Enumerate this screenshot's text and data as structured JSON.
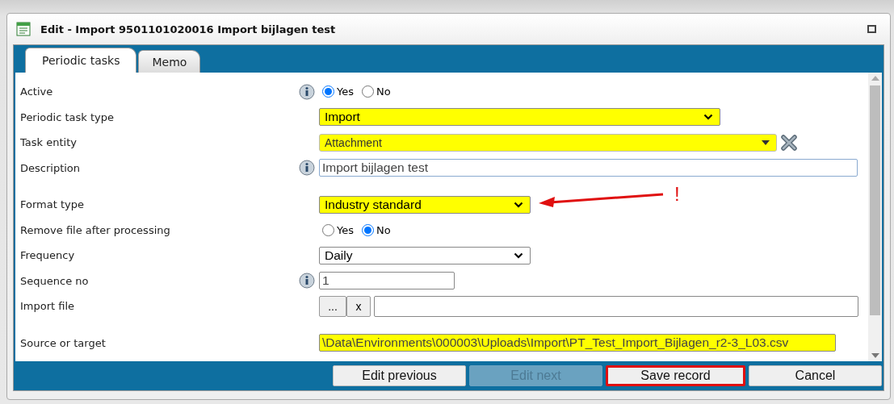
{
  "window": {
    "title": "Edit - Import 9501101020016 Import bijlagen test"
  },
  "tabs": [
    {
      "label": "Periodic tasks",
      "selected": true
    },
    {
      "label": "Memo",
      "selected": false
    }
  ],
  "fields": [
    {
      "label": "Active",
      "kind": "radio",
      "info": true,
      "options": [
        {
          "label": "Yes",
          "selected": true
        },
        {
          "label": "No",
          "selected": false
        }
      ]
    },
    {
      "label": "Periodic task type",
      "kind": "select",
      "info": false,
      "highlighted": true,
      "value": "Import"
    },
    {
      "label": "Task entity",
      "kind": "combo",
      "info": false,
      "highlighted": true,
      "value": "Attachment"
    },
    {
      "label": "Description",
      "kind": "text",
      "info": true,
      "highlighted": false,
      "value": "Import bijlagen test"
    },
    {
      "label": "Format type",
      "kind": "select",
      "info": false,
      "highlighted": true,
      "value": "Industry standard"
    },
    {
      "label": "Remove file after processing",
      "kind": "radio",
      "info": false,
      "options": [
        {
          "label": "Yes",
          "selected": false
        },
        {
          "label": "No",
          "selected": true
        }
      ]
    },
    {
      "label": "Frequency",
      "kind": "select",
      "info": false,
      "highlighted": false,
      "value": "Daily"
    },
    {
      "label": "Sequence no",
      "kind": "text",
      "info": true,
      "highlighted": false,
      "value": "1"
    },
    {
      "label": "Import file",
      "kind": "file",
      "info": false,
      "browse": "...",
      "clear": "x"
    },
    {
      "label": "Source or target",
      "kind": "text",
      "info": false,
      "highlighted": true,
      "value": "\\Data\\Environments\\000003\\Uploads\\Import\\PT_Test_Import_Bijlagen_r2-3_L03.csv"
    }
  ],
  "annotation": {
    "mark": "!"
  },
  "buttons": [
    {
      "label": "Edit previous",
      "disabled": false,
      "outlined": false
    },
    {
      "label": "Edit next",
      "disabled": true,
      "outlined": false
    },
    {
      "label": "Save record",
      "disabled": false,
      "outlined": true
    },
    {
      "label": "Cancel",
      "disabled": false,
      "outlined": false
    }
  ]
}
